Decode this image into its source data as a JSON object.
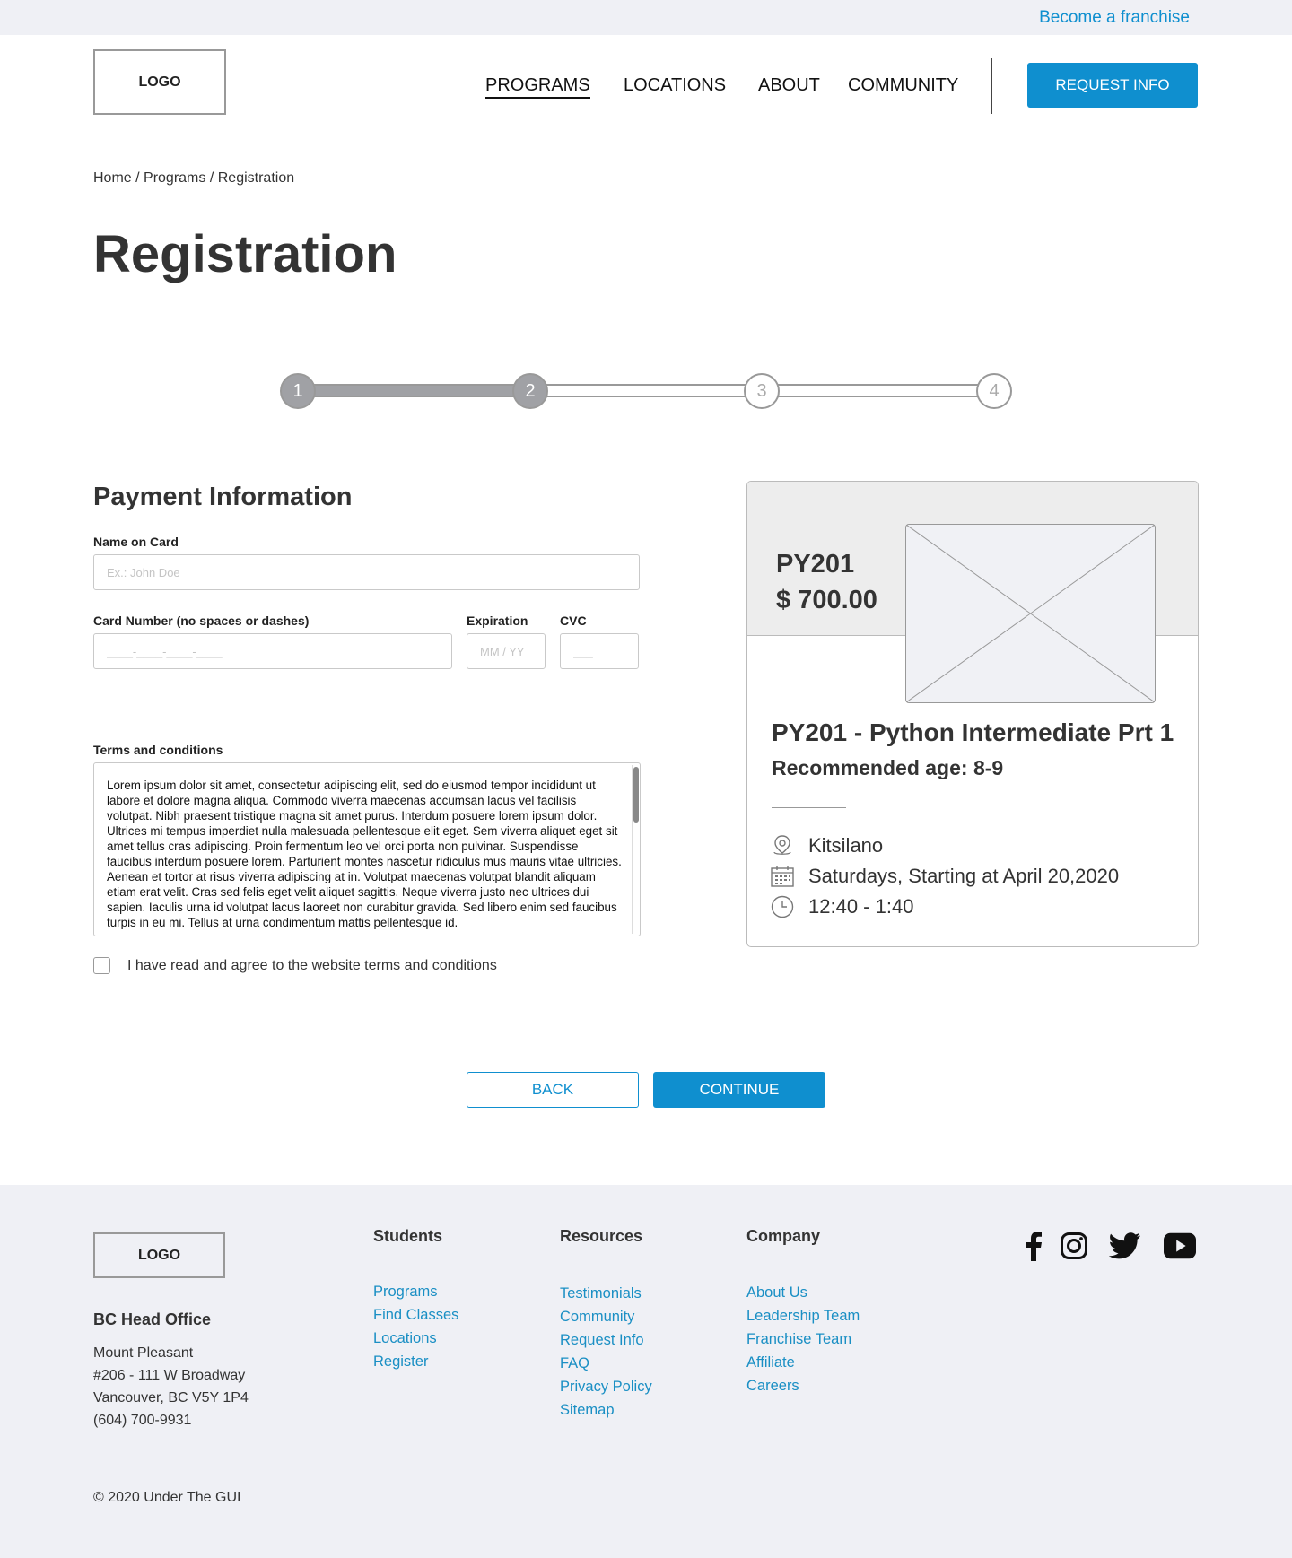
{
  "topbar": {
    "franchise_link": "Become a franchise"
  },
  "header": {
    "logo": "LOGO",
    "nav": [
      "PROGRAMS",
      "LOCATIONS",
      "ABOUT",
      "COMMUNITY"
    ],
    "request_button": "REQUEST INFO"
  },
  "breadcrumb": [
    "Home",
    "Programs",
    "Registration"
  ],
  "page_title": "Registration",
  "stepper": {
    "steps": [
      "1",
      "2",
      "3",
      "4"
    ],
    "current_step": 2
  },
  "payment": {
    "title": "Payment Information",
    "name_label": "Name on Card",
    "name_placeholder": "Ex.: John Doe",
    "card_label": "Card Number (no spaces or dashes)",
    "card_placeholder": "____-____-____-____",
    "expiration_label": "Expiration",
    "expiration_placeholder": "MM / YY",
    "cvc_label": "CVC",
    "cvc_placeholder": "___",
    "terms_label": "Terms and conditions",
    "terms_text": "Lorem ipsum dolor sit amet, consectetur adipiscing elit, sed do eiusmod tempor incididunt ut labore et dolore magna aliqua. Commodo viverra maecenas accumsan lacus vel facilisis volutpat. Nibh praesent tristique magna sit amet purus. Interdum posuere lorem ipsum dolor. Ultrices mi tempus imperdiet nulla malesuada pellentesque elit eget. Sem viverra aliquet eget sit amet tellus cras adipiscing. Proin fermentum leo vel orci porta non pulvinar. Suspendisse faucibus interdum posuere lorem. Parturient montes nascetur ridiculus mus mauris vitae ultricies. Aenean et tortor at risus viverra adipiscing at in. Volutpat maecenas volutpat blandit aliquam etiam erat velit. Cras sed felis eget velit aliquet sagittis. Neque viverra justo nec ultrices dui sapien. Iaculis urna id volutpat lacus laoreet non curabitur gravida. Sed libero enim sed faucibus turpis in eu mi. Tellus at urna condimentum mattis pellentesque id.",
    "agree_label": "I have read and agree to the website terms and conditions",
    "agree_checked": false
  },
  "course": {
    "code": "PY201",
    "price": "$ 700.00",
    "name": "PY201 - Python Intermediate Prt 1",
    "age": "Recommended age: 8-9",
    "details": [
      {
        "icon": "location-pin-icon",
        "text": "Kitsilano"
      },
      {
        "icon": "calendar-icon",
        "text": "Saturdays, Starting at April 20,2020"
      },
      {
        "icon": "clock-icon",
        "text": "12:40 - 1:40"
      }
    ]
  },
  "actions": {
    "back": "BACK",
    "continue": "CONTINUE"
  },
  "footer": {
    "logo": "LOGO",
    "office_title": "BC Head Office",
    "office_lines": [
      "Mount Pleasant",
      "#206 - 111 W Broadway",
      "Vancouver, BC V5Y 1P4",
      "(604) 700-9931"
    ],
    "columns": [
      {
        "title": "Students",
        "links": [
          "Programs",
          "Find Classes",
          "Locations",
          "Register"
        ]
      },
      {
        "title": "Resources",
        "links": [
          "Testimonials",
          "Community",
          "Request Info",
          "FAQ",
          "Privacy Policy",
          "Sitemap"
        ]
      },
      {
        "title": "Company",
        "links": [
          "About Us",
          "Leadership Team",
          "Franchise Team",
          "Affiliate",
          "Careers"
        ]
      }
    ],
    "social": [
      "facebook-icon",
      "instagram-icon",
      "twitter-icon",
      "youtube-icon"
    ],
    "copyright": "© 2020 Under The GUI"
  },
  "colors": {
    "accent": "#0f8fcf",
    "link": "#1a8fc4",
    "footer_bg": "#eff0f5",
    "step_done": "#a0a1a5"
  }
}
